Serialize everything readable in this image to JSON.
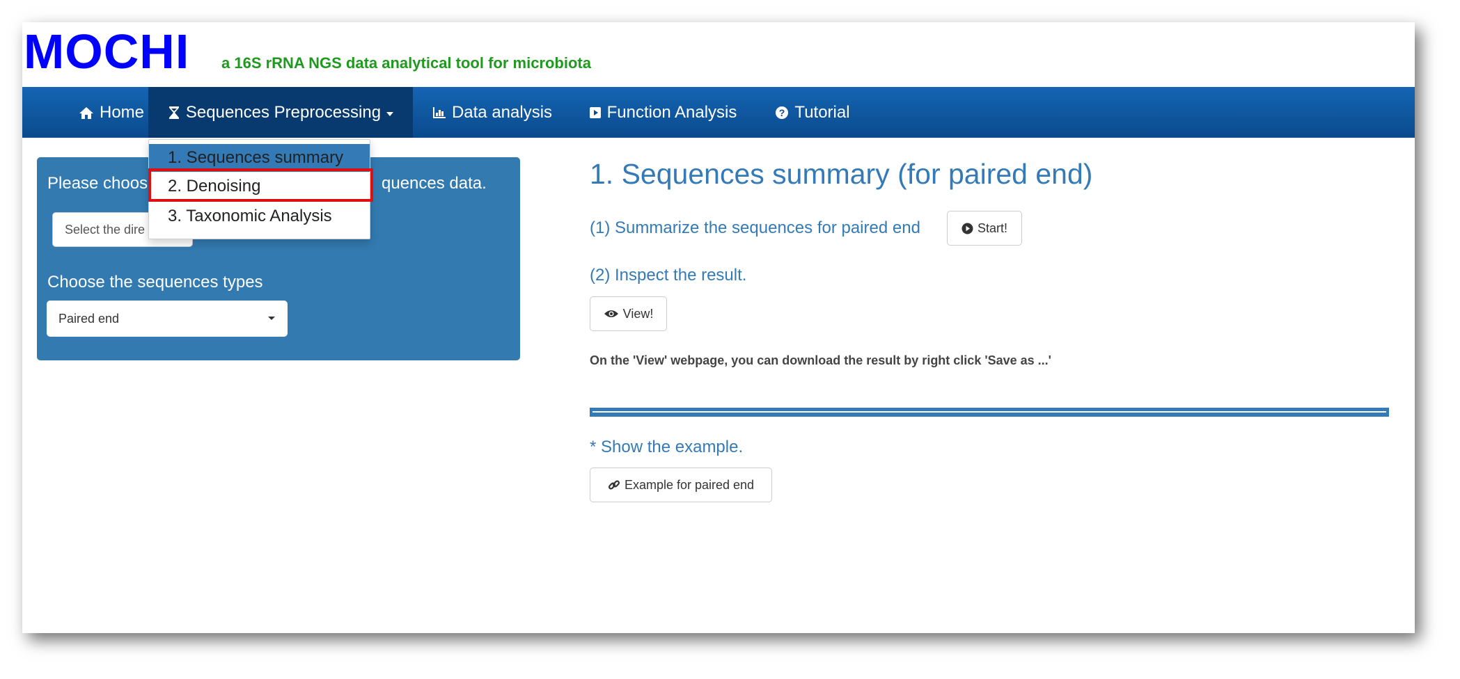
{
  "header": {
    "logo": "MOCHI",
    "tagline": "a 16S rRNA NGS data analytical tool for microbiota"
  },
  "nav": {
    "items": [
      {
        "label": "Home",
        "icon": "home-icon"
      },
      {
        "label": "Sequences Preprocessing",
        "icon": "hourglass-icon"
      },
      {
        "label": "Data analysis",
        "icon": "bar-chart-icon"
      },
      {
        "label": "Function Analysis",
        "icon": "play-square-icon"
      },
      {
        "label": "Tutorial",
        "icon": "question-circle-icon"
      }
    ]
  },
  "dropdown": {
    "items": [
      "1. Sequences summary",
      "2. Denoising",
      "3. Taxonomic Analysis"
    ]
  },
  "sidebar": {
    "choose_prefix": "Please choos",
    "choose_suffix": "quences data.",
    "dir_button": "Select the dire",
    "types_label": "Choose the sequences types",
    "types_value": "Paired end"
  },
  "main": {
    "title": "1. Sequences summary (for paired end)",
    "step1": "(1) Summarize the sequences for paired end",
    "start_button": "Start!",
    "step2": "(2) Inspect the result.",
    "view_button": "View!",
    "note": "On the 'View' webpage, you can download the result by right click 'Save as ...'",
    "example_heading": "* Show the example.",
    "example_button": "Example for paired end"
  },
  "colors": {
    "logo": "#0000ff",
    "tagline": "#1f9a1f",
    "navbar": "#0a4a8d",
    "accent": "#337ab7",
    "highlight": "#e01010"
  }
}
